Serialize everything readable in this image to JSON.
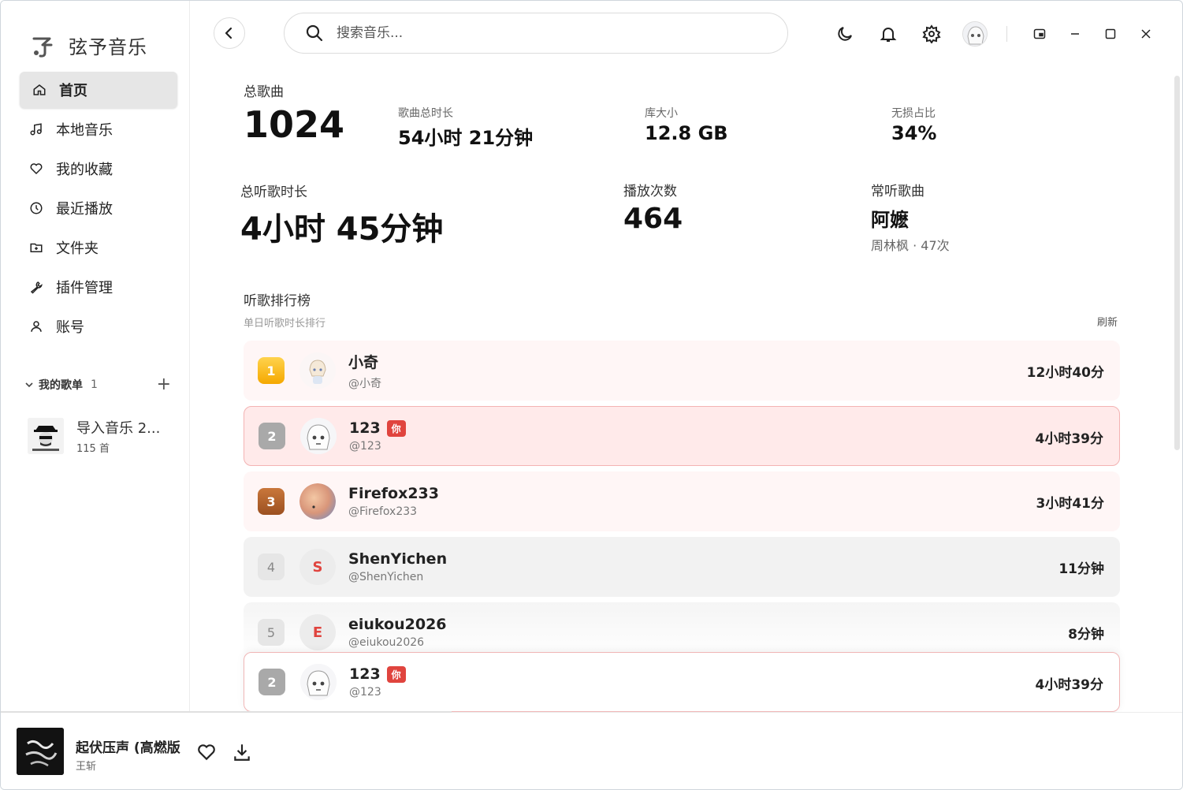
{
  "app": {
    "name": "弦予音乐"
  },
  "nav": [
    {
      "label": "首页",
      "icon": "home-icon",
      "active": true
    },
    {
      "label": "本地音乐",
      "icon": "music-note-icon"
    },
    {
      "label": "我的收藏",
      "icon": "heart-icon"
    },
    {
      "label": "最近播放",
      "icon": "clock-icon"
    },
    {
      "label": "文件夹",
      "icon": "folder-icon"
    },
    {
      "label": "插件管理",
      "icon": "wrench-icon"
    },
    {
      "label": "账号",
      "icon": "user-icon"
    }
  ],
  "playlists": {
    "title": "我的歌单",
    "count": "1",
    "add_label": "+",
    "items": [
      {
        "name": "导入音乐 2...",
        "count": "115 首"
      }
    ]
  },
  "search": {
    "placeholder": "搜索音乐..."
  },
  "stats": {
    "total_songs_label": "总歌曲",
    "total_songs": "1024",
    "duration_label": "歌曲总时长",
    "duration": "54小时 21分钟",
    "library_label": "库大小",
    "library": "12.8 GB",
    "lossless_label": "无损占比",
    "lossless": "34%",
    "listen_label": "总听歌时长",
    "listen": "4小时 45分钟",
    "plays_label": "播放次数",
    "plays": "464",
    "fav_label": "常听歌曲",
    "fav_song": "阿嬷",
    "fav_meta": "周林枫 · 47次"
  },
  "ranking": {
    "title": "听歌排行榜",
    "subtitle": "单日听歌时长排行",
    "refresh": "刷新",
    "you_tag": "你",
    "rows": [
      {
        "rank": "1",
        "name": "小奇",
        "handle": "@小奇",
        "time": "12小时40分"
      },
      {
        "rank": "2",
        "name": "123",
        "handle": "@123",
        "time": "4小时39分",
        "me": true
      },
      {
        "rank": "3",
        "name": "Firefox233",
        "handle": "@Firefox233",
        "time": "3小时41分"
      },
      {
        "rank": "4",
        "name": "ShenYichen",
        "handle": "@ShenYichen",
        "time": "11分钟",
        "letter": "S"
      },
      {
        "rank": "5",
        "name": "eiukou2026",
        "handle": "@eiukou2026",
        "time": "8分钟",
        "letter": "E"
      }
    ],
    "sticky": {
      "rank": "2",
      "name": "123",
      "handle": "@123",
      "time": "4小时39分"
    }
  },
  "player": {
    "title": "起伏压声 (高燃版",
    "artist": "王斩"
  },
  "colors": {
    "accent": "#e0443e",
    "gold": "#f5a800",
    "bronze": "#9c5020"
  }
}
